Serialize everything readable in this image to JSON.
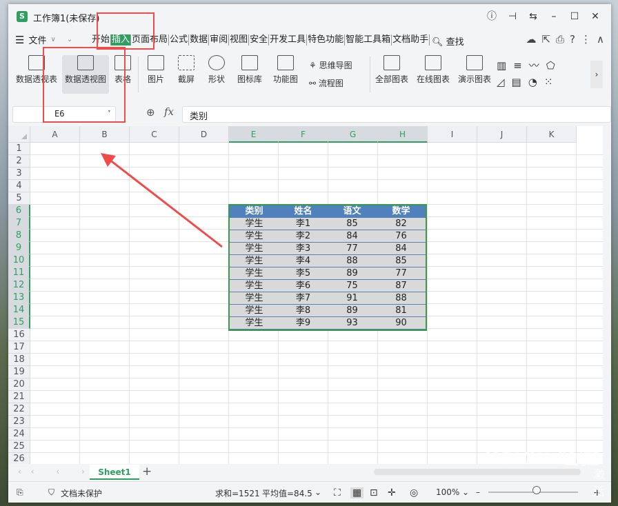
{
  "titlebar": {
    "app_icon": "S",
    "title": "工作簿1(未保存)"
  },
  "menubar": {
    "file_label": "文件",
    "tabs": [
      {
        "label": "开始",
        "active": false
      },
      {
        "label": "插入",
        "active": true
      },
      {
        "label": "页面布局",
        "active": false
      },
      {
        "label": "公式",
        "active": false
      },
      {
        "label": "数据",
        "active": false
      },
      {
        "label": "审阅",
        "active": false
      },
      {
        "label": "视图",
        "active": false
      },
      {
        "label": "安全",
        "active": false
      },
      {
        "label": "开发工具",
        "active": false
      },
      {
        "label": "特色功能",
        "active": false
      },
      {
        "label": "智能工具箱",
        "active": false
      },
      {
        "label": "文档助手",
        "active": false
      }
    ],
    "search_label": "查找"
  },
  "ribbon": {
    "pivot_table": "数据透视表",
    "pivot_chart": "数据透视图",
    "table": "表格",
    "picture": "图片",
    "screenshot": "截屏",
    "shape": "形状",
    "icon_lib": "图标库",
    "function_chart": "功能图",
    "mind_map": "思维导图",
    "flow_chart": "流程图",
    "all_charts": "全部图表",
    "online_charts": "在线图表",
    "demo_charts": "演示图表"
  },
  "formula": {
    "cell_ref": "E6",
    "fx": "fx",
    "content": "类别"
  },
  "columns": [
    "A",
    "B",
    "C",
    "D",
    "E",
    "F",
    "G",
    "H",
    "I",
    "J",
    "K"
  ],
  "rows": [
    "1",
    "2",
    "3",
    "4",
    "5",
    "6",
    "7",
    "8",
    "9",
    "10",
    "11",
    "12",
    "13",
    "14",
    "15",
    "16",
    "17",
    "18",
    "19",
    "20",
    "21",
    "22",
    "23",
    "24",
    "25",
    "26"
  ],
  "table": {
    "headers": [
      "类别",
      "姓名",
      "语文",
      "数学"
    ],
    "rows": [
      [
        "学生",
        "李1",
        "85",
        "82"
      ],
      [
        "学生",
        "李2",
        "84",
        "76"
      ],
      [
        "学生",
        "李3",
        "77",
        "84"
      ],
      [
        "学生",
        "李4",
        "88",
        "85"
      ],
      [
        "学生",
        "李5",
        "89",
        "77"
      ],
      [
        "学生",
        "李6",
        "75",
        "87"
      ],
      [
        "学生",
        "李7",
        "91",
        "88"
      ],
      [
        "学生",
        "李8",
        "89",
        "81"
      ],
      [
        "学生",
        "李9",
        "93",
        "90"
      ]
    ]
  },
  "sheets": {
    "active": "Sheet1",
    "add": "+"
  },
  "status": {
    "protect": "文档未保护",
    "sum": "求和=1521",
    "avg": "平均值=84.5",
    "zoom": "100%"
  },
  "watermark": {
    "brand": "Baidu 经验",
    "activate": "激活"
  },
  "colors": {
    "accent": "#2f9f5f",
    "header_fill": "#4f81bd",
    "highlight": "#f04a4a"
  }
}
